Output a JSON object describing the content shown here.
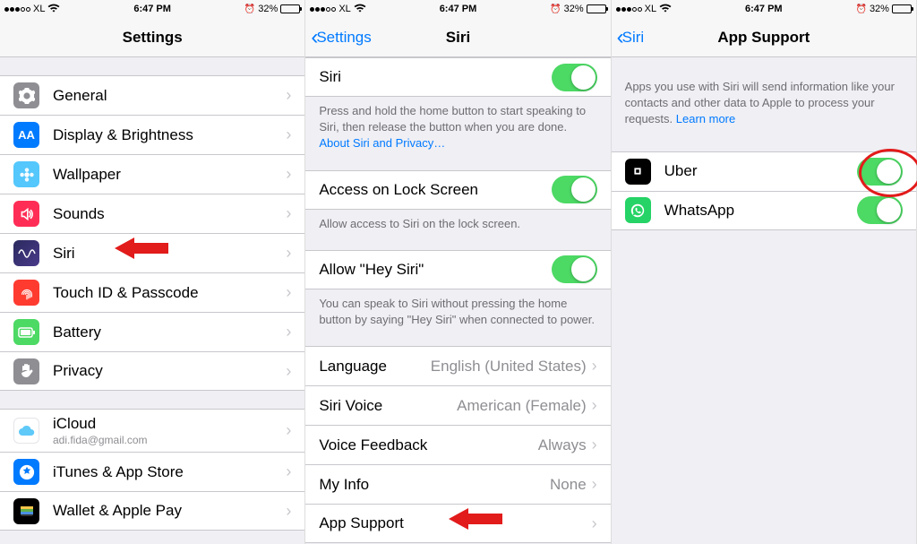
{
  "status_bar": {
    "carrier": "XL",
    "time": "6:47 PM",
    "battery_pct": "32%"
  },
  "screen1": {
    "title": "Settings",
    "group1": [
      {
        "label": "General",
        "icon": "gear"
      },
      {
        "label": "Display & Brightness",
        "icon": "text-size"
      },
      {
        "label": "Wallpaper",
        "icon": "flower"
      },
      {
        "label": "Sounds",
        "icon": "speaker"
      },
      {
        "label": "Siri",
        "icon": "siri"
      },
      {
        "label": "Touch ID & Passcode",
        "icon": "fingerprint"
      },
      {
        "label": "Battery",
        "icon": "battery"
      },
      {
        "label": "Privacy",
        "icon": "hand"
      }
    ],
    "group2": [
      {
        "label": "iCloud",
        "subtitle": "adi.fida@gmail.com",
        "icon": "cloud"
      },
      {
        "label": "iTunes & App Store",
        "icon": "appstore"
      },
      {
        "label": "Wallet & Apple Pay",
        "icon": "wallet"
      }
    ]
  },
  "screen2": {
    "back": "Settings",
    "title": "Siri",
    "siri_label": "Siri",
    "siri_footer_a": "Press and hold the home button to start speaking to Siri, then release the button when you are done. ",
    "siri_footer_link": "About Siri and Privacy…",
    "lock_label": "Access on Lock Screen",
    "lock_footer": "Allow access to Siri on the lock screen.",
    "hey_label": "Allow \"Hey Siri\"",
    "hey_footer": "You can speak to Siri without pressing the home button by saying \"Hey Siri\" when connected to power.",
    "rows": {
      "language": {
        "label": "Language",
        "value": "English (United States)"
      },
      "voice": {
        "label": "Siri Voice",
        "value": "American (Female)"
      },
      "feedback": {
        "label": "Voice Feedback",
        "value": "Always"
      },
      "myinfo": {
        "label": "My Info",
        "value": "None"
      },
      "appsupport": {
        "label": "App Support"
      }
    }
  },
  "screen3": {
    "back": "Siri",
    "title": "App Support",
    "footer_a": "Apps you use with Siri will send information like your contacts and other data to Apple to process your requests. ",
    "footer_link": "Learn more",
    "apps": [
      {
        "label": "Uber",
        "icon": "uber"
      },
      {
        "label": "WhatsApp",
        "icon": "whatsapp"
      }
    ]
  }
}
